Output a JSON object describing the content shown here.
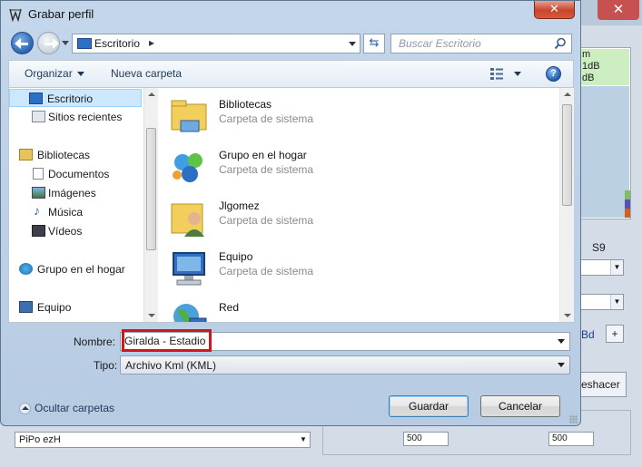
{
  "dialog": {
    "title": "Grabar perfil",
    "close_glyph": "✕"
  },
  "nav": {
    "address": "Escritorio",
    "address_chevron": "▸",
    "refresh_glyph": "⇆",
    "search_placeholder": "Buscar Escritorio"
  },
  "toolbar": {
    "organize_label": "Organizar",
    "new_folder_label": "Nueva carpeta",
    "help_glyph": "?"
  },
  "sidebar": {
    "items": [
      {
        "label": "Escritorio",
        "icon": "desktop-icon"
      },
      {
        "label": "Sitios recientes",
        "icon": "recent-places-icon"
      },
      {
        "label": "Bibliotecas",
        "icon": "libraries-icon"
      },
      {
        "label": "Documentos",
        "icon": "documents-icon"
      },
      {
        "label": "Imágenes",
        "icon": "pictures-icon"
      },
      {
        "label": "Música",
        "icon": "music-icon"
      },
      {
        "label": "Vídeos",
        "icon": "videos-icon"
      },
      {
        "label": "Grupo en el hogar",
        "icon": "homegroup-icon"
      },
      {
        "label": "Equipo",
        "icon": "computer-icon"
      }
    ]
  },
  "content": {
    "items": [
      {
        "name": "Bibliotecas",
        "desc": "Carpeta de sistema",
        "icon": "libraries-icon"
      },
      {
        "name": "Grupo en el hogar",
        "desc": "Carpeta de sistema",
        "icon": "homegroup-icon"
      },
      {
        "name": "Jlgomez",
        "desc": "Carpeta de sistema",
        "icon": "user-folder-icon"
      },
      {
        "name": "Equipo",
        "desc": "Carpeta de sistema",
        "icon": "computer-icon"
      },
      {
        "name": "Red",
        "desc": "",
        "icon": "network-icon"
      }
    ]
  },
  "form": {
    "name_label": "Nombre:",
    "name_value": "Giralda - Estadio",
    "type_label": "Tipo:",
    "type_value": "Archivo Kml (KML)"
  },
  "footer": {
    "hide_folders_label": "Ocultar carpetas",
    "save_label": "Guardar",
    "cancel_label": "Cancelar"
  },
  "background_app": {
    "close_glyph": "✕",
    "chart_lines": [
      "m",
      "1dB",
      "dB"
    ],
    "s9_label": "S9",
    "bd_label": "Bd",
    "plus_label": "+",
    "undo_label": "eshacer",
    "profile_value": "PiPo ezH",
    "min_value": "500",
    "max_value": "500"
  },
  "colors": {
    "highlight": "#d4161b",
    "selection": "#cce8ff"
  }
}
